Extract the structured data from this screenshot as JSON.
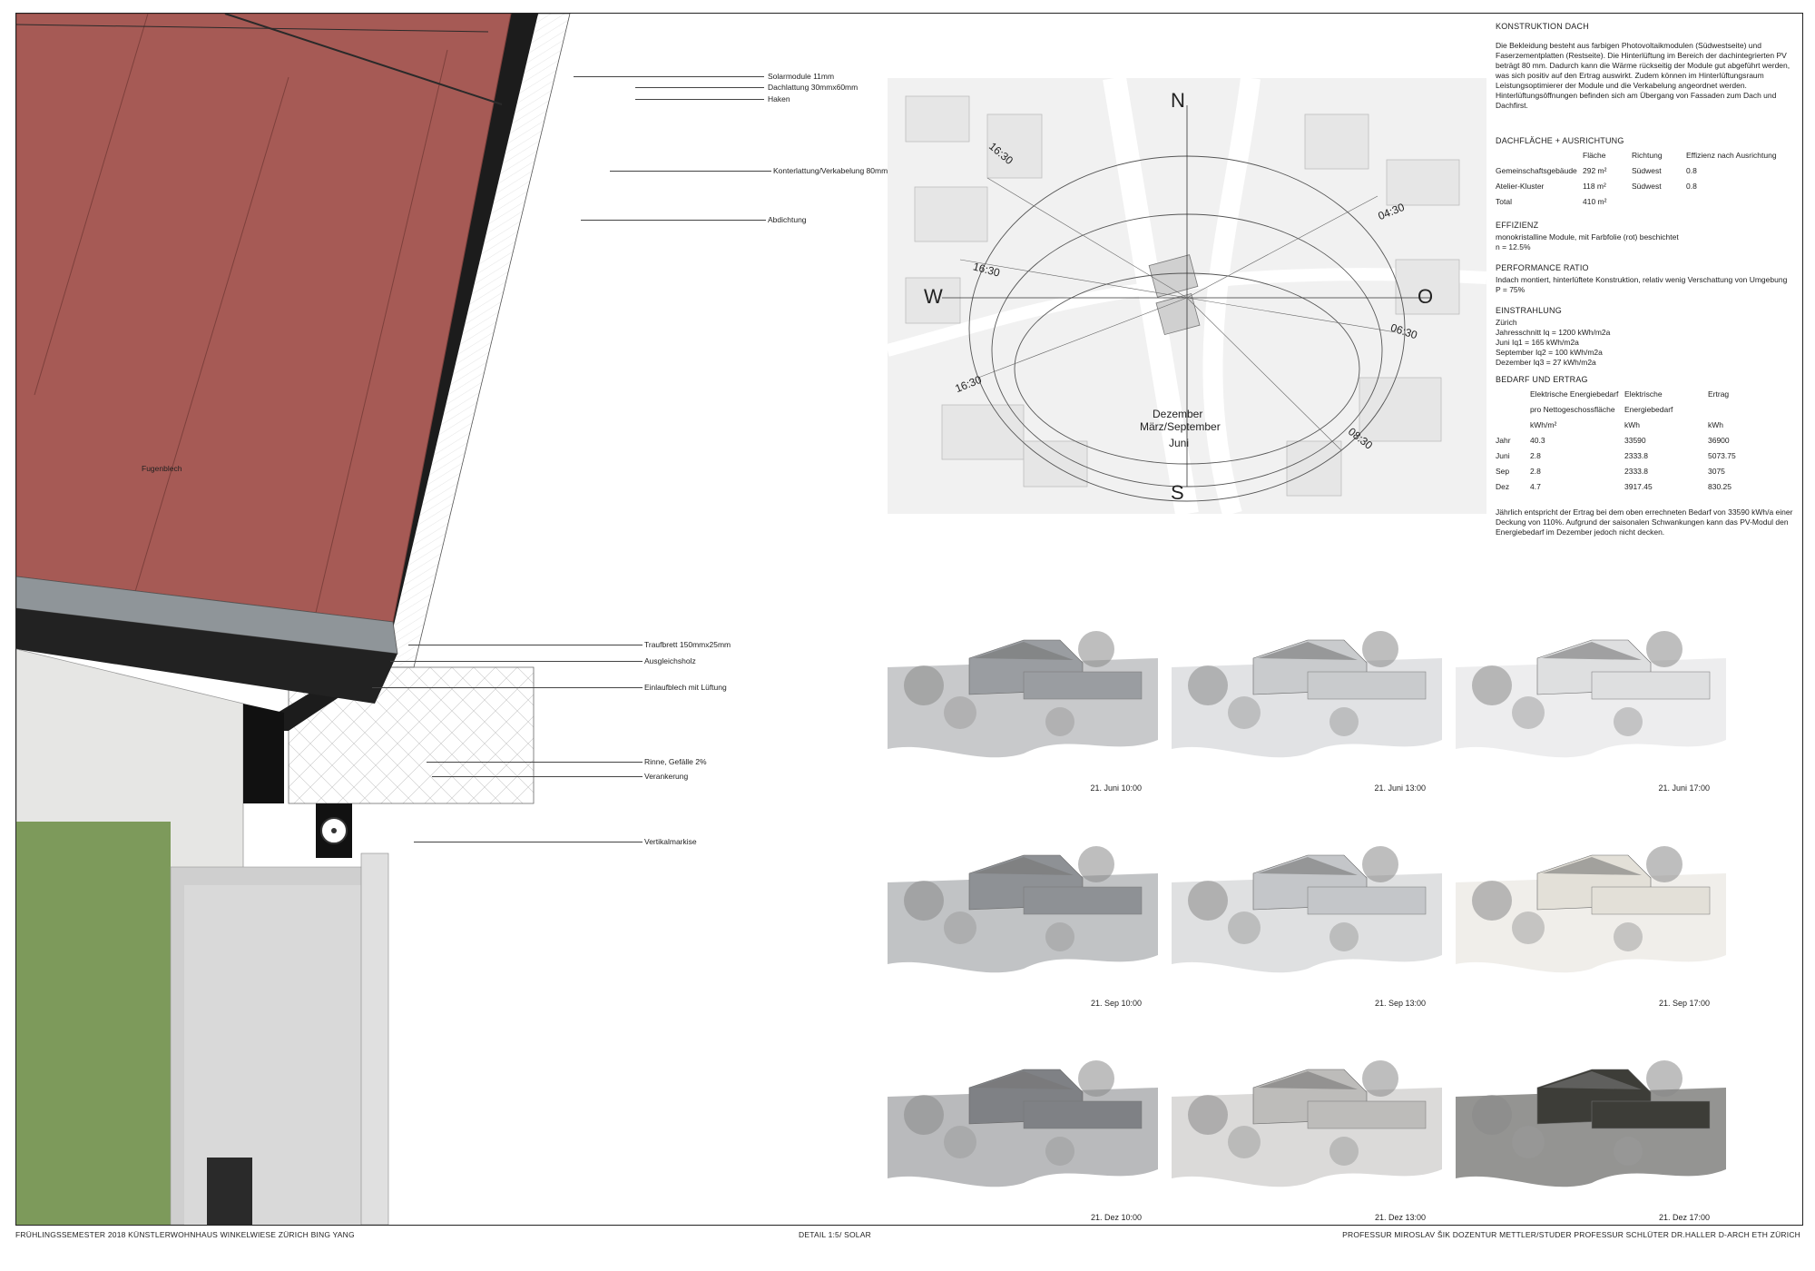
{
  "detail_labels": {
    "solarmodule": "Solarmodule 11mm",
    "dachlattung": "Dachlattung  30mmx60mm",
    "haken": "Haken",
    "konterlattung": "Konterlattung/Verkabelung 80mm",
    "abdichtung": "Abdichtung",
    "fugenblech": "Fugenblech",
    "traufbrett": "Traufbrett  150mmx25mm",
    "ausgleichsholz": "Ausgleichsholz",
    "einlaufblech": "Einlaufblech mit Lüftung",
    "rinne": "Rinne, Gefälle 2%",
    "verankerung": "Verankerung",
    "vertikalmarkise": "Vertikalmarkise"
  },
  "site_plan": {
    "compass": {
      "n": "N",
      "s": "S",
      "w": "W",
      "o": "O"
    },
    "times": {
      "t1": "16:30",
      "t2": "16:30",
      "t3": "16:30",
      "t4": "04:30",
      "t5": "06:30",
      "t6": "08:30"
    },
    "months": {
      "m1": "Dezember",
      "m2": "März/September",
      "m3": "Juni"
    }
  },
  "info": {
    "konstruktion_title": "KONSTRUKTION DACH",
    "konstruktion_text": "Die Bekleidung besteht aus farbigen Photovoltaikmodulen (Südwestseite) und Faserzementplatten (Restseite). Die Hinterlüftung im Bereich der dachintegrierten PV beträgt 80 mm. Dadurch kann die Wärme rückseitig der Module gut abgeführt werden, was sich positiv auf den Ertrag auswirkt. Zudem können im Hinterlüftungsraum Leistungsoptimierer der Module und die Verkabelung angeordnet werden. Hinterlüftungsöffnungen befinden sich am Übergang von Fassaden zum Dach und Dachfirst.",
    "dach_title": "DACHFLÄCHE + AUSRICHTUNG",
    "dach_headers": [
      "",
      "Fläche",
      "Richtung",
      "Effizienz nach Ausrichtung"
    ],
    "dach_rows": [
      [
        "Gemeinschaftsgebäude",
        "292 m²",
        "Südwest",
        "0.8"
      ],
      [
        "Atelier-Kluster",
        "118 m²",
        "Südwest",
        "0.8"
      ],
      [
        "Total",
        "410 m²",
        "",
        ""
      ]
    ],
    "eff_title": "EFFIZIENZ",
    "eff_l1": "monokristalline Module, mit Farbfolie (rot) beschichtet",
    "eff_l2": "n = 12.5%",
    "perf_title": "PERFORMANCE RATIO",
    "perf_l1": "Indach montiert, hinterlüftete Konstruktion, relativ wenig Verschattung von Umgebung",
    "perf_l2": "P = 75%",
    "einst_title": "EINSTRAHLUNG",
    "einst_lines": [
      "Zürich",
      "Jahresschnitt Iq = 1200 kWh/m2a",
      "Juni Iq1 = 165 kWh/m2a",
      "September Iq2 = 100 kWh/m2a",
      "Dezember Iq3 = 27 kWh/m2a"
    ],
    "bedarf_title": "BEDARF UND ERTRAG",
    "bedarf_head1": [
      "",
      "Elektrische  Energiebedarf",
      "Elektrische",
      "Ertrag"
    ],
    "bedarf_head2": [
      "",
      "pro Nettogeschossfläche",
      "Energiebedarf",
      ""
    ],
    "bedarf_head3": [
      "",
      "kWh/m²",
      "kWh",
      "kWh"
    ],
    "bedarf_rows": [
      [
        "Jahr",
        "40.3",
        "33590",
        "36900"
      ],
      [
        "Juni",
        "2.8",
        "2333.8",
        "5073.75"
      ],
      [
        "Sep",
        "2.8",
        "2333.8",
        "3075"
      ],
      [
        "Dez",
        "4.7",
        "3917.45",
        "830.25"
      ]
    ],
    "conclusion": "Jährlich entspricht der Ertrag bei dem oben errechneten Bedarf von 33590 kWh/a einer Deckung von 110%. Aufgrund der saisonalen Schwankungen kann das PV-Modul den Energiebedarf im Dezember jedoch nicht decken."
  },
  "renderings": [
    {
      "caption": "21. Juni 10:00",
      "tone": "#9a9da1"
    },
    {
      "caption": "21. Juni 13:00",
      "tone": "#c9cbcd"
    },
    {
      "caption": "21. Juni 17:00",
      "tone": "#dedfe0"
    },
    {
      "caption": "21. Sep  10:00",
      "tone": "#8e9195"
    },
    {
      "caption": "21. Sep 13:00",
      "tone": "#c4c6c9"
    },
    {
      "caption": "21. Sep  17:00",
      "tone": "#e3e0d8"
    },
    {
      "caption": "21. Dez  10:00",
      "tone": "#7f8185"
    },
    {
      "caption": "21. Dez  13:00",
      "tone": "#bdbcba"
    },
    {
      "caption": "21. Dez  17:00",
      "tone": "#3d3d38"
    }
  ],
  "footer": {
    "left": "FRÜHLINGSSEMESTER 2018   KÜNSTLERWOHNHAUS WINKELWIESE ZÜRICH   BING YANG",
    "center": "DETAIL 1:5/ SOLAR",
    "right": "PROFESSUR MIROSLAV ŠIK   DOZENTUR METTLER/STUDER   PROFESSUR SCHLÜTER DR.HALLER   D-ARCH ETH ZÜRICH"
  },
  "colors": {
    "roof_red": "#a65a55",
    "wall_green": "#7d9a5b",
    "concrete": "#e6e6e4"
  }
}
